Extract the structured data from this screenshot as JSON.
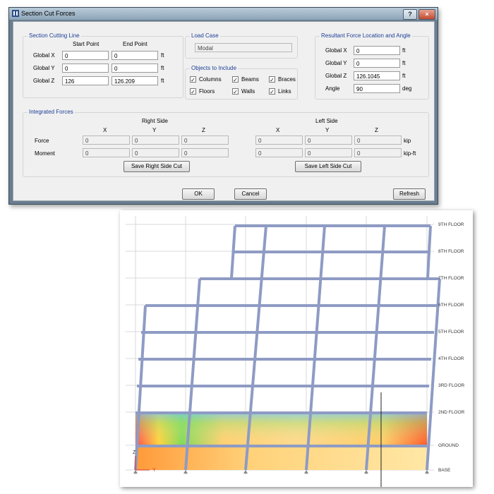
{
  "dialog": {
    "title": "Section Cut Forces",
    "help_label": "?",
    "close_label": "×",
    "section_cutting_line": {
      "title": "Section Cutting Line",
      "start_header": "Start Point",
      "end_header": "End Point",
      "rows": [
        {
          "axis": "Global  X",
          "start": "0",
          "end": "0",
          "unit": "ft"
        },
        {
          "axis": "Global  Y",
          "start": "0",
          "end": "0",
          "unit": "ft"
        },
        {
          "axis": "Global  Z",
          "start": "126",
          "end": "126.209",
          "unit": "ft"
        }
      ]
    },
    "load_case": {
      "title": "Load Case",
      "value": "Modal"
    },
    "objects": {
      "title": "Objects to Include",
      "items": [
        {
          "label": "Columns",
          "checked": "✓"
        },
        {
          "label": "Beams",
          "checked": "✓"
        },
        {
          "label": "Braces",
          "checked": "✓"
        },
        {
          "label": "Floors",
          "checked": "✓"
        },
        {
          "label": "Walls",
          "checked": "✓"
        },
        {
          "label": "Links",
          "checked": "✓"
        }
      ]
    },
    "resultant": {
      "title": "Resultant Force Location and Angle",
      "rows": [
        {
          "label": "Global  X",
          "value": "0",
          "unit": "ft"
        },
        {
          "label": "Global  Y",
          "value": "0",
          "unit": "ft"
        },
        {
          "label": "Global  Z",
          "value": "126.1045",
          "unit": "ft"
        },
        {
          "label": "Angle",
          "value": "90",
          "unit": "deg"
        }
      ]
    },
    "integrated": {
      "title": "Integrated Forces",
      "right_side": "Right Side",
      "left_side": "Left Side",
      "axis_x": "X",
      "axis_y": "Y",
      "axis_z": "Z",
      "force_label": "Force",
      "moment_label": "Moment",
      "right_force": [
        "0",
        "0",
        "0"
      ],
      "right_moment": [
        "0",
        "0",
        "0"
      ],
      "left_force": [
        "0",
        "0",
        "0"
      ],
      "left_moment": [
        "0",
        "0",
        "0"
      ],
      "force_unit": "kip",
      "moment_unit": "kip-ft",
      "save_right": "Save Right Side Cut",
      "save_left": "Save Left Side Cut"
    },
    "buttons": {
      "ok": "OK",
      "cancel": "Cancel",
      "refresh": "Refresh"
    }
  },
  "view": {
    "floor_labels": [
      "9TH FLOOR",
      "8TH FLOOR",
      "7TH FLOOR",
      "6TH FLOOR",
      "5TH FLOOR",
      "4TH FLOOR",
      "3RD FLOOR",
      "2ND FLOOR",
      "GROUND",
      "BASE"
    ],
    "axis_z": "Z",
    "axis_y": "Y",
    "frame_color": "#8e9bc4",
    "grid_color": "#d8d8d8"
  }
}
